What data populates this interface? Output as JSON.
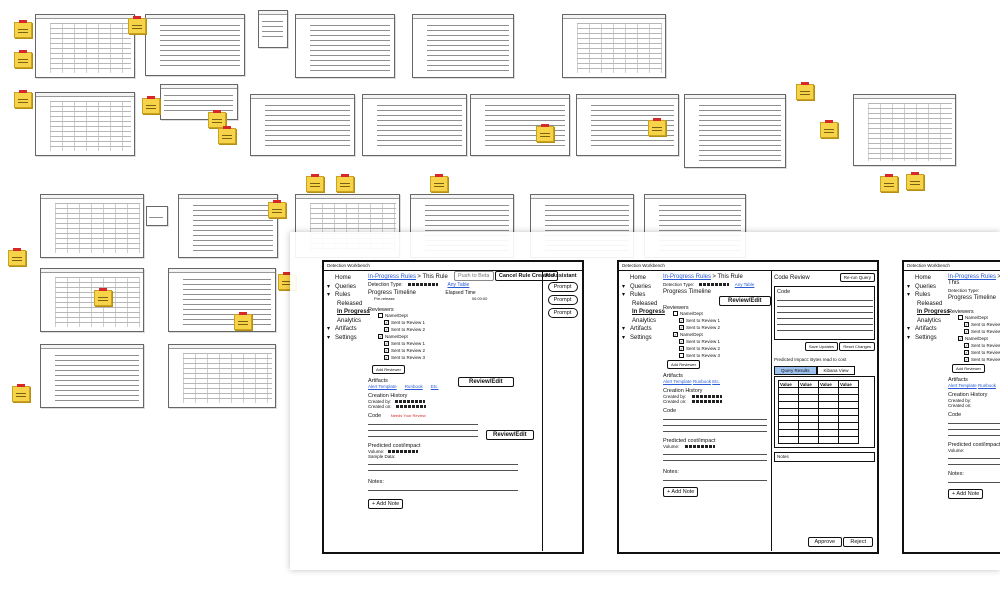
{
  "panel1": {
    "window_title": "Detection Workbench",
    "nav": [
      {
        "label": "Home",
        "level": 0,
        "arrow": ""
      },
      {
        "label": "Queries",
        "level": 0,
        "arrow": "▾"
      },
      {
        "label": "Rules",
        "level": 0,
        "arrow": "▾"
      },
      {
        "label": "Released",
        "level": 1,
        "arrow": ""
      },
      {
        "label": "In Progress",
        "level": 1,
        "arrow": "",
        "active": true
      },
      {
        "label": "Analytics",
        "level": 1,
        "arrow": ""
      },
      {
        "label": "Artifacts",
        "level": 0,
        "arrow": "▾"
      },
      {
        "label": "Settings",
        "level": 0,
        "arrow": "▾"
      }
    ],
    "breadcrumb_link": "In-Progress Rules",
    "breadcrumb_current": "> This Rule",
    "push_button": "Push to Beta",
    "cancel_button": "Cancel Rule Creation",
    "detection_type_label": "Detection Type:",
    "detection_type_link": "Any Table",
    "progress_timeline_label": "Progress Timeline",
    "elapsed_label": "Elapsed Time",
    "elapsed_value": "00:00:00",
    "pre_release": "Pre-release",
    "reviewers_title": "Reviewers",
    "reviewer_groups": [
      {
        "name": "Name/Dept",
        "items": [
          "Sent to Review 1",
          "Sent to Review 2"
        ]
      },
      {
        "name": "Name/Dept",
        "items": [
          "Sent to Review 1",
          "Sent to Review 2",
          "Sent to Review 3"
        ]
      }
    ],
    "add_reviewer": "Add Reviewer",
    "artifacts_title": "Artifacts",
    "artifacts_links": [
      "Alert Template",
      "Runbook",
      "Etc."
    ],
    "review_edit": "Review/Edit",
    "creation_history_title": "Creation History",
    "created_by": "Created by:",
    "created_on": "Created on:",
    "code_title": "Code",
    "code_note": "Needs Your Review",
    "predicted_title": "Predicted cost/impact",
    "volume_label": "Volume:",
    "sample_label": "Sample Data:",
    "notes_title": "Notes:",
    "add_note": "+ Add Note",
    "ai_title": "AI Assistant",
    "ai_prompts": [
      "Prompt",
      "Prompt",
      "Prompt"
    ]
  },
  "panel2": {
    "window_title": "Detection Workbench",
    "breadcrumb_link": "In-Progress Rules",
    "breadcrumb_current": "> This Rule",
    "code_review_title": "Code Review",
    "rerun_button": "Re-run Query",
    "code_box_title": "Code",
    "save_updates": "Save Updates",
    "reset_changes": "Reset Changes",
    "impact_label": "Predicted Impact: Bytes read to cost",
    "tabs": [
      "Query Results",
      "Kibana View"
    ],
    "table_header": [
      "Value",
      "Value",
      "Value",
      "Value"
    ],
    "notes_label": "Notes",
    "approve": "Approve",
    "reject": "Reject"
  },
  "panel3": {
    "window_title": "Detection Workbench",
    "breadcrumb_link": "In-Progress Rules",
    "breadcrumb_current": "> This"
  }
}
